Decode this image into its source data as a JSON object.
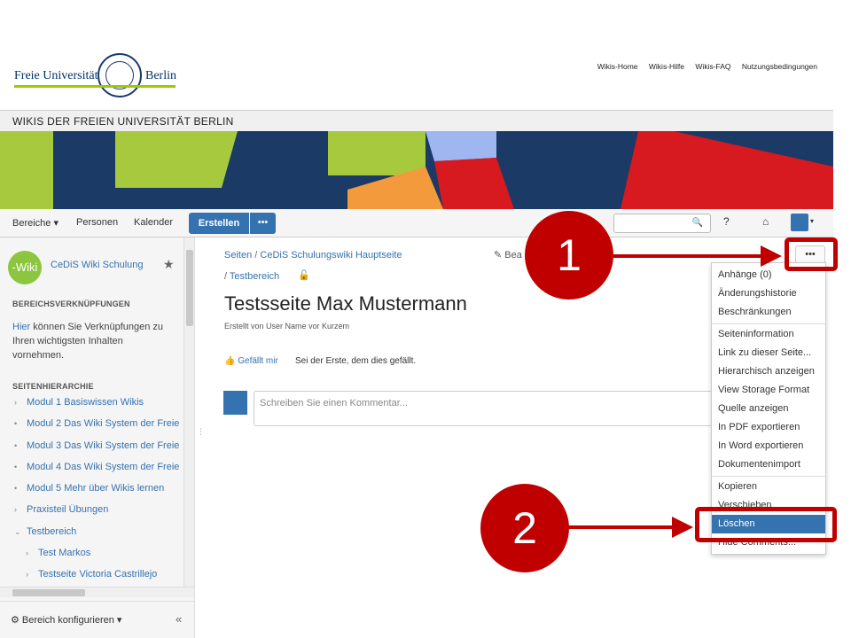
{
  "header": {
    "logo_left": "Freie Universität",
    "logo_right": "Berlin",
    "links": [
      "Wikis-Home",
      "Wikis-Hilfe",
      "Wikis-FAQ",
      "Nutzungsbedingungen"
    ],
    "site_title": "WIKIS DER FREIEN UNIVERSITÄT BERLIN"
  },
  "nav": {
    "items": [
      "Bereiche ▾",
      "Personen",
      "Kalender"
    ],
    "create_label": "Erstellen",
    "more_label": "•••",
    "search_icon": "🔍",
    "help_icon": "?",
    "inbox_icon": "⌂",
    "user_caret": "▾"
  },
  "sidebar": {
    "space_logo": "-Wiki",
    "space_name": "CeDiS Wiki Schulung",
    "star_icon": "★",
    "links_heading": "BEREICHSVERKNÜPFUNGEN",
    "links_text_link": "Hier",
    "links_text": " können Sie Verknüpfungen zu Ihren wichtigsten Inhalten vornehmen.",
    "hierarchy_heading": "SEITENHIERARCHIE",
    "tree": [
      {
        "bullet": "›",
        "label": "Modul 1 Basiswissen Wikis"
      },
      {
        "bullet": "•",
        "label": "Modul 2 Das Wiki System der Freie"
      },
      {
        "bullet": "•",
        "label": "Modul 3 Das Wiki System der Freie"
      },
      {
        "bullet": "•",
        "label": "Modul 4 Das Wiki System der Freie"
      },
      {
        "bullet": "•",
        "label": "Modul 5 Mehr über Wikis lernen"
      },
      {
        "bullet": "›",
        "label": "Praxisteil Übungen"
      },
      {
        "bullet": "⌄",
        "label": "Testbereich"
      },
      {
        "bullet": "›",
        "label": "Test Markos"
      },
      {
        "bullet": "›",
        "label": "Testseite Victoria Castrillejo"
      }
    ],
    "config_label": "⚙ Bereich konfigurieren ▾",
    "collapse_icon": "«"
  },
  "main": {
    "breadcrumb_1": "Seiten",
    "breadcrumb_2": "CeDiS Schulungswiki Hauptseite",
    "breadcrumb_3": "Testbereich",
    "edit_label": "✎ Bea",
    "title": "Testsseite Max Mustermann",
    "meta": "Erstellt von User Name vor Kurzem",
    "like_label": "Gefällt mir",
    "like_text": "Sei der Erste, dem dies gefällt.",
    "comment_placeholder": "Schreiben Sie einen Kommentar...",
    "more_actions": "•••"
  },
  "dropdown": {
    "group1": [
      "Anhänge (0)",
      "Änderungshistorie",
      "Beschränkungen"
    ],
    "group2": [
      "Seiteninformation",
      "Link zu dieser Seite...",
      "Hierarchisch anzeigen",
      "View Storage Format",
      "Quelle anzeigen",
      "In PDF exportieren",
      "In Word exportieren",
      "Dokumentenimport"
    ],
    "group3": [
      "Kopieren",
      "Verschieben",
      "Löschen",
      "Hide Comments..."
    ],
    "selected": "Löschen"
  },
  "annotations": {
    "callout_1": "1",
    "callout_2": "2",
    "highlight_color": "#c00000"
  },
  "colors": {
    "accent": "#3572b0",
    "logo_green": "#99cc00",
    "annotation_red": "#c00000"
  }
}
